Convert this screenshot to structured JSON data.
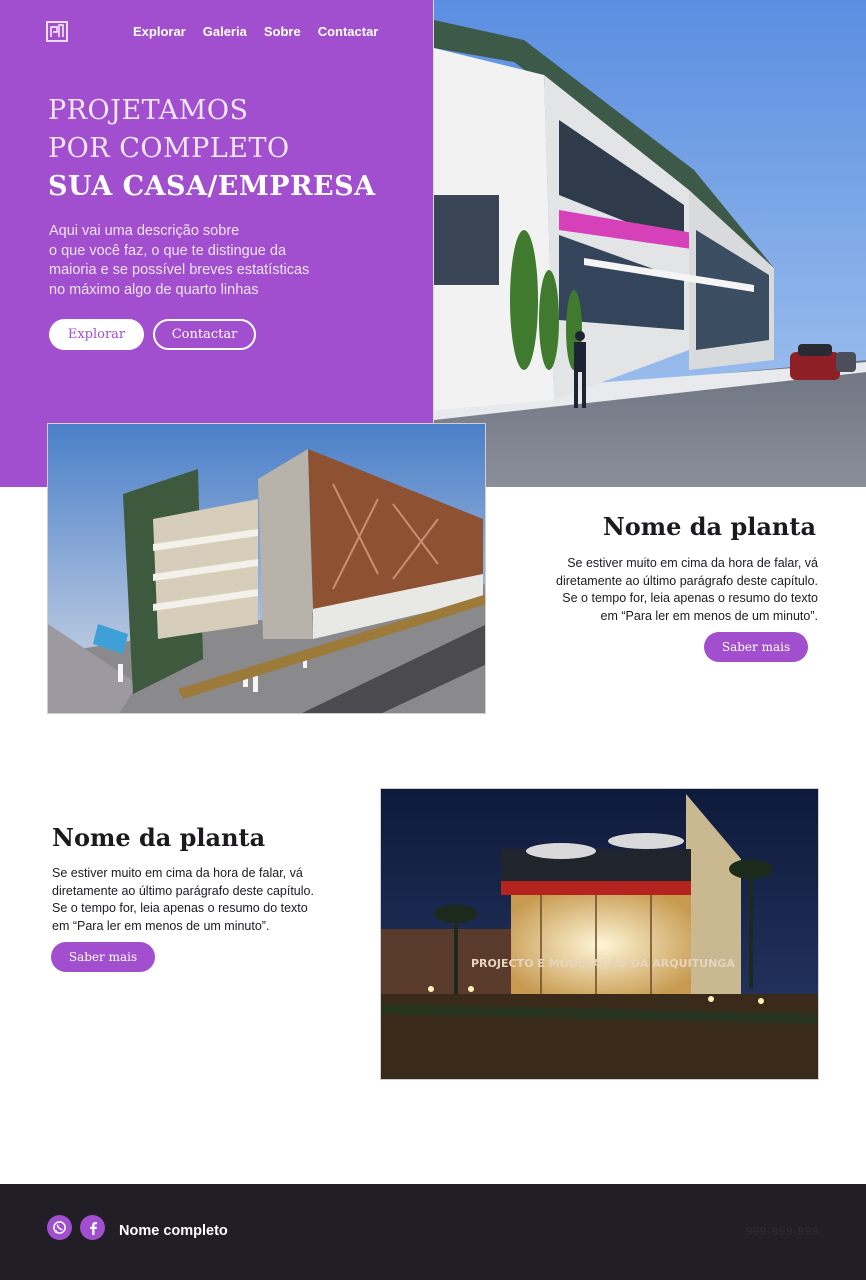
{
  "header": {
    "logo_icon": "house-logo-icon",
    "nav": [
      "Explorar",
      "Galeria",
      "Sobre",
      "Contactar"
    ]
  },
  "hero": {
    "title_line1": "PROJETAMOS",
    "title_line2": "POR COMPLETO",
    "title_line3": "SUA CASA/EMPRESA",
    "desc_lines": [
      "Aqui vai uma descrição sobre",
      "o que você faz, o que te distingue da",
      "maioria e se possível breves estatísticas",
      "no máximo algo de quarto linhas"
    ],
    "btn_explore": "Explorar",
    "btn_contact": "Contactar",
    "accent_color": "#a14fcf"
  },
  "projects": [
    {
      "title": "Nome da planta",
      "desc_lines": [
        "Se estiver muito em cima da hora de falar, vá",
        "diretamente ao último parágrafo deste capítulo.",
        "Se o tempo for, leia apenas o resumo do texto",
        "em “Para ler em menos de um minuto”."
      ],
      "button": "Saber mais"
    },
    {
      "title": "Nome da planta",
      "desc_lines": [
        "Se estiver muito em cima da hora de falar, vá",
        "diretamente ao último parágrafo deste capítulo.",
        "Se o tempo for, leia apenas o resumo do texto",
        "em “Para ler em menos de um minuto”."
      ],
      "button": "Saber mais",
      "image_sign": "PROJECTO E MODELAÇÃO DA ARQUITUNGA"
    }
  ],
  "footer": {
    "name": "Nome completo",
    "phone": "999-999-999",
    "icons": [
      "whatsapp-icon",
      "facebook-icon"
    ],
    "bg_color": "#221e25"
  }
}
